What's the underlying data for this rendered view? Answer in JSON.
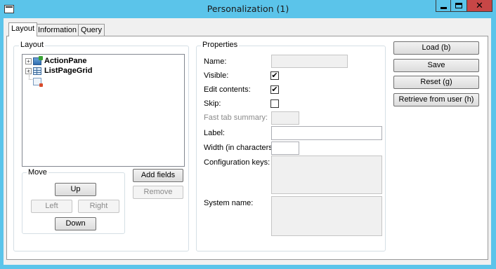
{
  "window": {
    "title": "Personalization (1)",
    "close_glyph": "✕"
  },
  "tabs": [
    {
      "label": "Layout",
      "active": true
    },
    {
      "label": "Information",
      "active": false
    },
    {
      "label": "Query",
      "active": false
    }
  ],
  "layout": {
    "legend": "Layout",
    "tree": [
      {
        "label": "ActionPane",
        "icon": "action-pane-icon",
        "expander": "+"
      },
      {
        "label": "ListPageGrid",
        "icon": "grid-icon",
        "expander": "+"
      },
      {
        "label": "",
        "icon": "blank-node-icon",
        "expander": ""
      }
    ]
  },
  "move": {
    "legend": "Move",
    "up": "Up",
    "left": "Left",
    "right": "Right",
    "down": "Down"
  },
  "actions": {
    "add_fields": "Add fields",
    "remove": "Remove"
  },
  "properties": {
    "legend": "Properties",
    "name_label": "Name:",
    "name_value": "",
    "visible_label": "Visible:",
    "visible_checked": true,
    "edit_label": "Edit contents:",
    "edit_checked": true,
    "skip_label": "Skip:",
    "skip_checked": false,
    "fasttab_label": "Fast tab summary:",
    "label_label": "Label:",
    "label_value": "",
    "width_label": "Width (in characters):",
    "width_value": "",
    "config_label": "Configuration keys:",
    "system_label": "System name:",
    "check_glyph": "✔"
  },
  "side_buttons": {
    "load": "Load (b)",
    "save": "Save",
    "reset": "Reset (g)",
    "retrieve": "Retrieve from user (h)"
  },
  "colors": {
    "titlebar": "#5bc4ea",
    "close_button": "#c74646"
  }
}
